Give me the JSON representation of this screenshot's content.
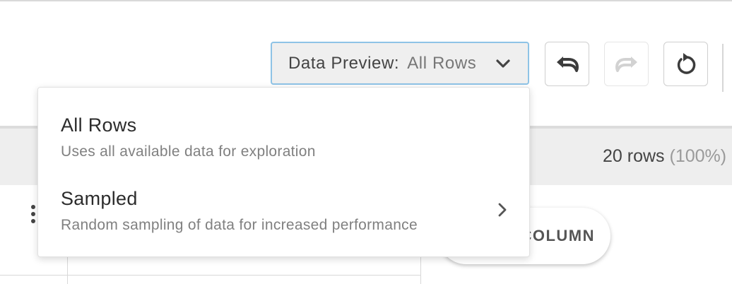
{
  "toolbar": {
    "preview_label": "Data Preview:",
    "preview_value": "All Rows",
    "icons": {
      "dropdown": "chevron-down-icon",
      "undo": "undo-icon",
      "redo": "redo-icon",
      "reset": "reset-icon"
    }
  },
  "status": {
    "rows_count": "20 rows",
    "rows_percent": "(100%)"
  },
  "grid": {
    "add_column_label": "COLUMN"
  },
  "menu": {
    "items": [
      {
        "title": "All Rows",
        "description": "Uses all available data for exploration"
      },
      {
        "title": "Sampled",
        "description": "Random sampling of data for increased performance"
      }
    ]
  },
  "colors": {
    "select_border": "#8ec3e6",
    "select_bg": "#efefef",
    "band_bg": "#eeeeee"
  }
}
